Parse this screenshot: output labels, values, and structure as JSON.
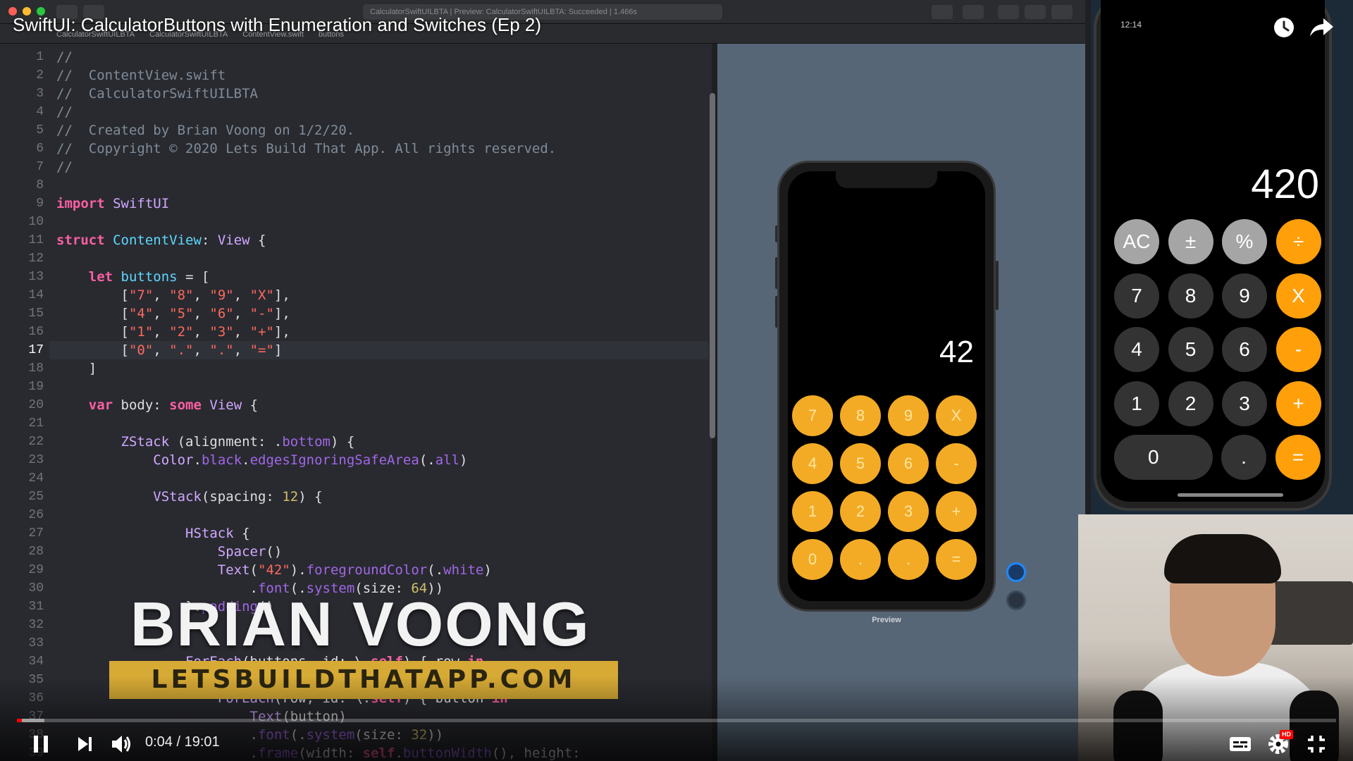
{
  "video": {
    "title": "SwiftUI: CalculatorButtons with Enumeration and Switches (Ep 2)",
    "current_time": "0:04",
    "duration": "19:01",
    "time_sep": " / ",
    "progress_fraction": 0.0035,
    "buffered_fraction": 0.021
  },
  "xcode": {
    "status_text": "CalculatorSwiftUILBTA | Preview: CalculatorSwiftUILBTA: Succeeded | 1.466s",
    "breadcrumbs": [
      "CalculatorSwiftUILBTA",
      "CalculatorSwiftUILBTA",
      "ContentView.swift",
      "buttons"
    ],
    "current_line": 17,
    "code_lines": [
      "//",
      "//  ContentView.swift",
      "//  CalculatorSwiftUILBTA",
      "//",
      "//  Created by Brian Voong on 1/2/20.",
      "//  Copyright © 2020 Lets Build That App. All rights reserved.",
      "//",
      "",
      "import SwiftUI",
      "",
      "struct ContentView: View {",
      "",
      "    let buttons = [",
      "        [\"7\", \"8\", \"9\", \"X\"],",
      "        [\"4\", \"5\", \"6\", \"-\"],",
      "        [\"1\", \"2\", \"3\", \"+\"],",
      "        [\"0\", \".\", \".\", \"=\"]",
      "    ]",
      "",
      "    var body: some View {",
      "",
      "        ZStack (alignment: .bottom) {",
      "            Color.black.edgesIgnoringSafeArea(.all)",
      "",
      "            VStack(spacing: 12) {",
      "",
      "                HStack {",
      "                    Spacer()",
      "                    Text(\"42\").foregroundColor(.white)",
      "                        .font(.system(size: 64))",
      "                }.padding()",
      "",
      "",
      "                ForEach(buttons, id: \\.self) { row in",
      "",
      "                    ForEach(row, id: \\.self) { button in",
      "                        Text(button)",
      "                        .font(.system(size: 32))",
      "                        .frame(width: self.buttonWidth(), height:"
    ]
  },
  "preview": {
    "label": "Preview",
    "display": "42",
    "buttons": [
      "7",
      "8",
      "9",
      "X",
      "4",
      "5",
      "6",
      "-",
      "1",
      "2",
      "3",
      "+",
      "0",
      ".",
      ".",
      "="
    ],
    "button_color": "#f3ab26"
  },
  "device": {
    "time": "12:14",
    "display": "420",
    "rows": [
      [
        "AC",
        "±",
        "%",
        "÷"
      ],
      [
        "7",
        "8",
        "9",
        "X"
      ],
      [
        "4",
        "5",
        "6",
        "-"
      ],
      [
        "1",
        "2",
        "3",
        "+"
      ]
    ],
    "zero": "0",
    "dot": ".",
    "equals": "="
  },
  "brand": {
    "name": "BRIAN VOONG",
    "url": "LETSBUILDTHATAPP.COM",
    "banner_color": "#d6aa35"
  },
  "icons": {
    "watch_later": "clock-icon",
    "share": "share-arrow-icon",
    "pause": "pause-icon",
    "next": "next-icon",
    "volume": "volume-icon",
    "captions": "captions-icon",
    "settings": "gear-icon",
    "hd_badge": "HD",
    "exit_fullscreen": "exit-fullscreen-icon"
  },
  "colors": {
    "accent_red": "#ff0000",
    "ios_orange": "#ff9f0a"
  }
}
